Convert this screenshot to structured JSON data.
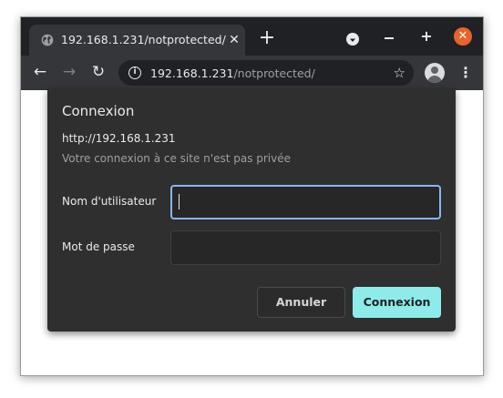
{
  "browser": {
    "tab": {
      "title": "192.168.1.231/notprotected/",
      "close": "✕",
      "favicon": "globe-icon"
    },
    "new_tab": "+",
    "window_controls": {
      "minimize": "",
      "maximize": "+",
      "close": "✕"
    },
    "toolbar": {
      "back": "←",
      "forward": "→",
      "reload": "↻",
      "url_host": "192.168.1.231",
      "url_path": "/notprotected/",
      "star": "☆",
      "menu": "⋮"
    }
  },
  "dialog": {
    "title": "Connexion",
    "origin": "http://192.168.1.231",
    "warning": "Votre connexion à ce site n'est pas privée",
    "username_label": "Nom d'utilisateur",
    "username_value": "",
    "password_label": "Mot de passe",
    "password_value": "",
    "cancel_label": "Annuler",
    "submit_label": "Connexion"
  },
  "colors": {
    "titlebar": "#202124",
    "toolbar": "#35363a",
    "dialog": "#2f2f2f",
    "focus_ring": "#8ab4f8",
    "submit_button": "#8eebeb",
    "window_close": "#e9632c"
  }
}
